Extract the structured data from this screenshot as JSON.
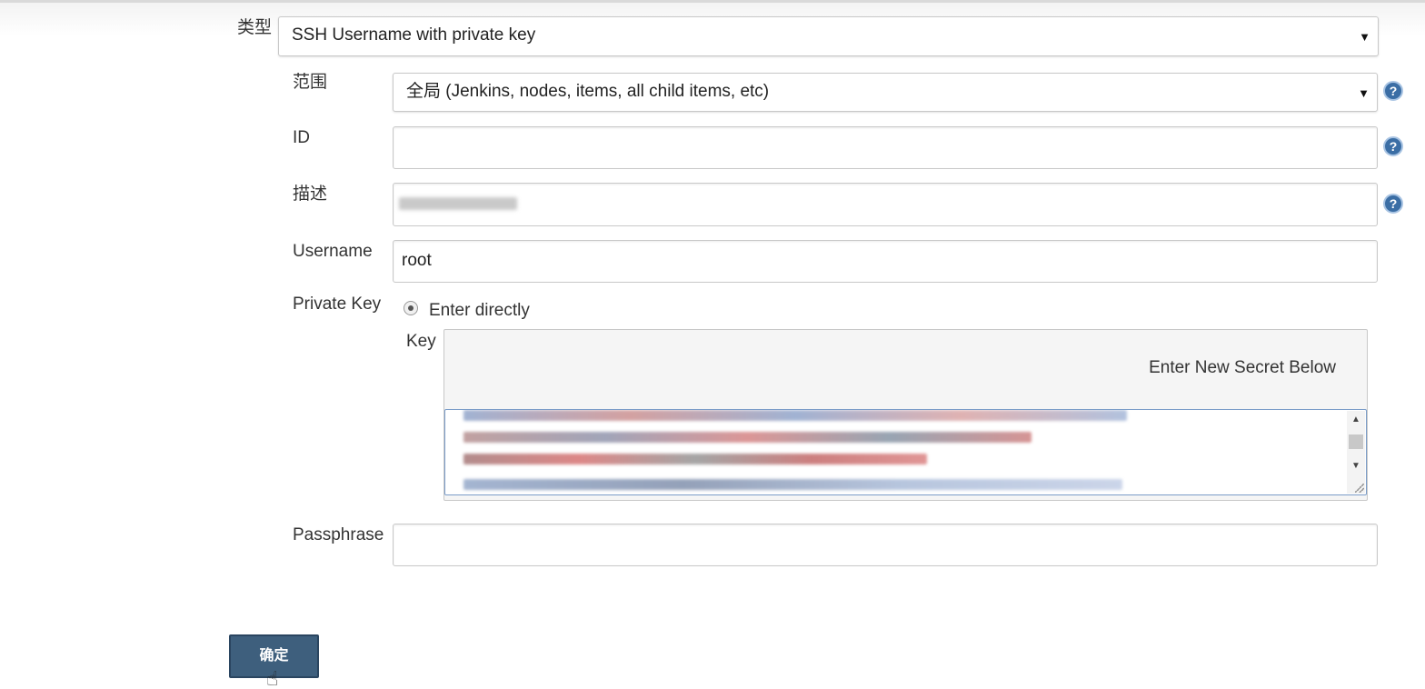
{
  "form": {
    "kind": {
      "label": "类型",
      "value": "SSH Username with private key"
    },
    "scope": {
      "label": "范围",
      "value": "全局 (Jenkins, nodes, items, all child items, etc)"
    },
    "id": {
      "label": "ID",
      "value": ""
    },
    "description": {
      "label": "描述",
      "value": ""
    },
    "username": {
      "label": "Username",
      "value": "root"
    },
    "private_key": {
      "label": "Private Key",
      "option_label": "Enter directly",
      "key_label": "Key",
      "secret_hint": "Enter New Secret Below"
    },
    "passphrase": {
      "label": "Passphrase",
      "value": ""
    }
  },
  "actions": {
    "ok_label": "确定"
  },
  "icons": {
    "dropdown": "caret-down-icon",
    "help": "question-circle-icon",
    "cursor": "hand-pointer-icon"
  },
  "colors": {
    "button_bg": "#3e5f7d",
    "help_icon": "#3b6ea5",
    "textarea_border": "#7a9cc8"
  }
}
